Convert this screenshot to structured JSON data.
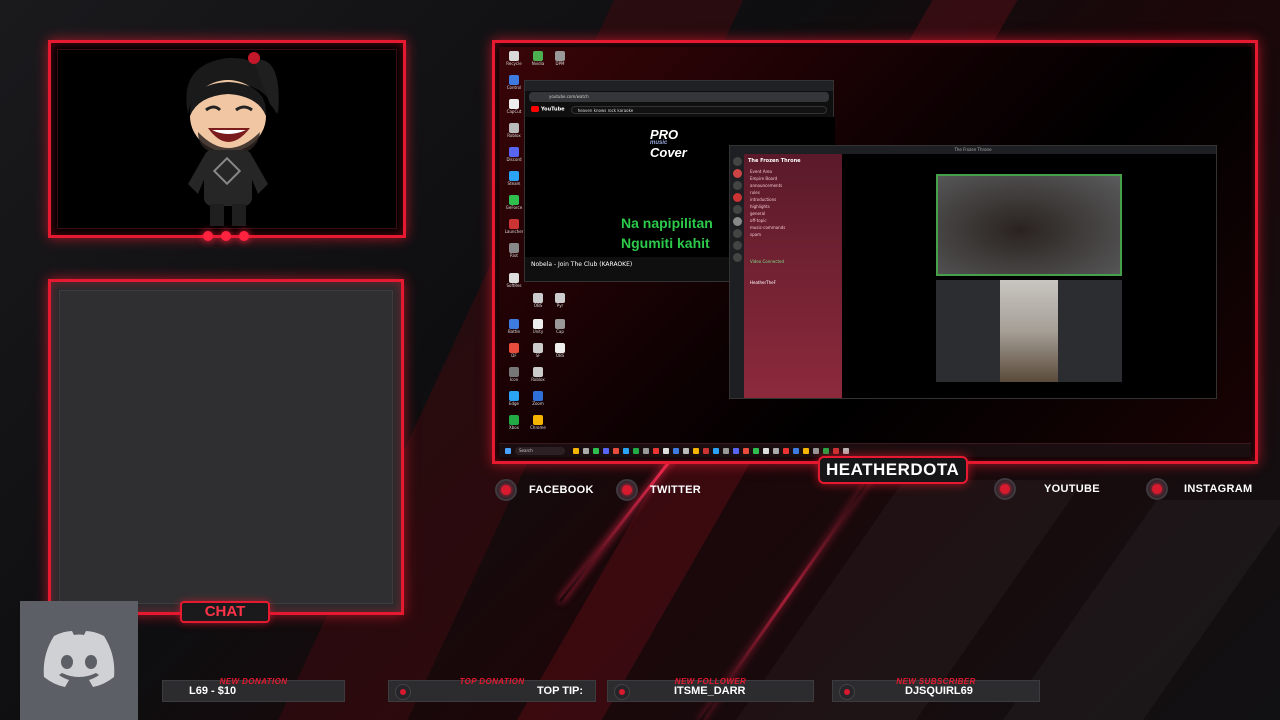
{
  "overlay": {
    "streamer_name": "HEATHERDOTA",
    "chat_label": "CHAT",
    "socials": [
      {
        "label": "FACEBOOK"
      },
      {
        "label": "TWITTER"
      },
      {
        "label": "YOUTUBE"
      },
      {
        "label": "INSTAGRAM"
      }
    ],
    "alerts": {
      "donation": {
        "badge": "NEW DONATION",
        "value": "L69 - $10"
      },
      "top_donation": {
        "badge": "TOP DONATION",
        "value": "TOP TIP:"
      },
      "follower": {
        "badge": "NEW FOLLOWER",
        "value": "ITSME_DARR"
      },
      "subscriber": {
        "badge": "NEW SUBSCRIBER",
        "value": "DJSQUIRL69"
      }
    },
    "accent_color": "#e5192f"
  },
  "youtube": {
    "search": "heaven knows rock karaoke",
    "logo": "YouTube",
    "pro_cover": [
      "PRO",
      "music",
      "Cover"
    ],
    "lyrics": [
      "Na napipilitan",
      "Ngumiti kahit"
    ],
    "video_title": "Nobela - Join The Club (KARAOKE)"
  },
  "discord": {
    "server_name": "The Frozen Throne",
    "window_title": "The Frozen Throne",
    "channels": [
      "Event Area",
      "Empire Board",
      "announcements",
      "rules",
      "introductions",
      "highlights",
      "general",
      "off-topic",
      "music-commands",
      "spam"
    ],
    "voice_status": "Video Connected",
    "user": "HeatherTheF"
  },
  "taskbar": {
    "search": "Search"
  }
}
